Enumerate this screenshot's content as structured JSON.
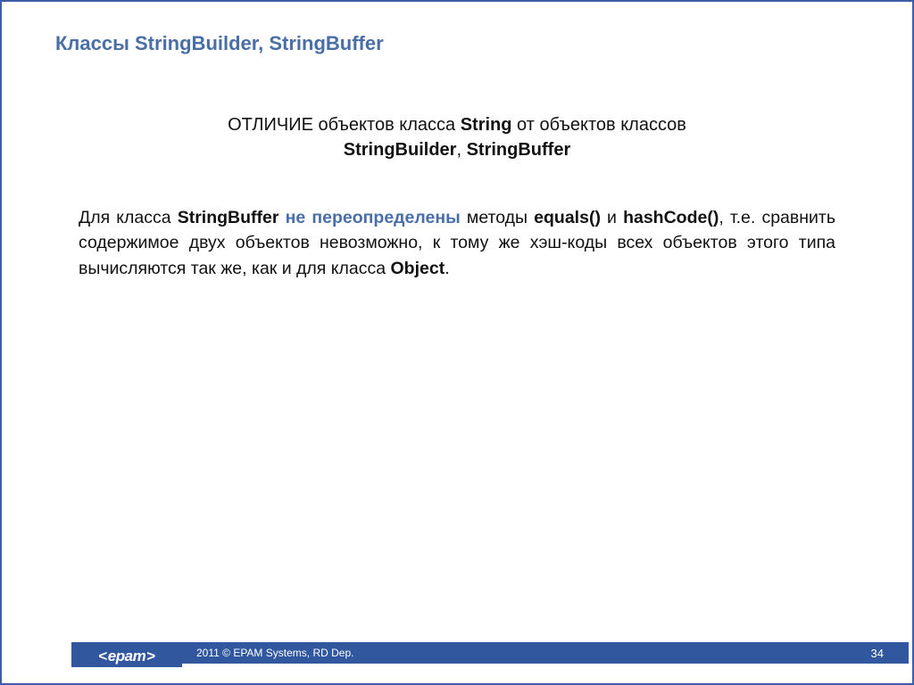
{
  "title": "Классы StringBuilder, StringBuffer",
  "subtitle": {
    "pre": "ОТЛИЧИЕ объектов класса ",
    "strong1": "String",
    "mid": " от объектов классов ",
    "line2a": "StringBuilder",
    "line2sep": ", ",
    "line2b": "StringBuffer"
  },
  "body": {
    "t1": "Для класса ",
    "b1": "StringBuffer",
    "h1": " не переопределены ",
    "t2": "методы ",
    "b2": "equals()",
    "t3": " и ",
    "b3": "hashCode()",
    "t4": ", т.е. сравнить содержимое двух объектов невозможно, к тому же хэш-коды всех объектов этого типа вычисляются так же, как и для класса ",
    "b4": "Object",
    "t5": "."
  },
  "footer": {
    "logo": "epam",
    "copyright": "2011 © EPAM Systems, RD Dep.",
    "page": "34"
  }
}
